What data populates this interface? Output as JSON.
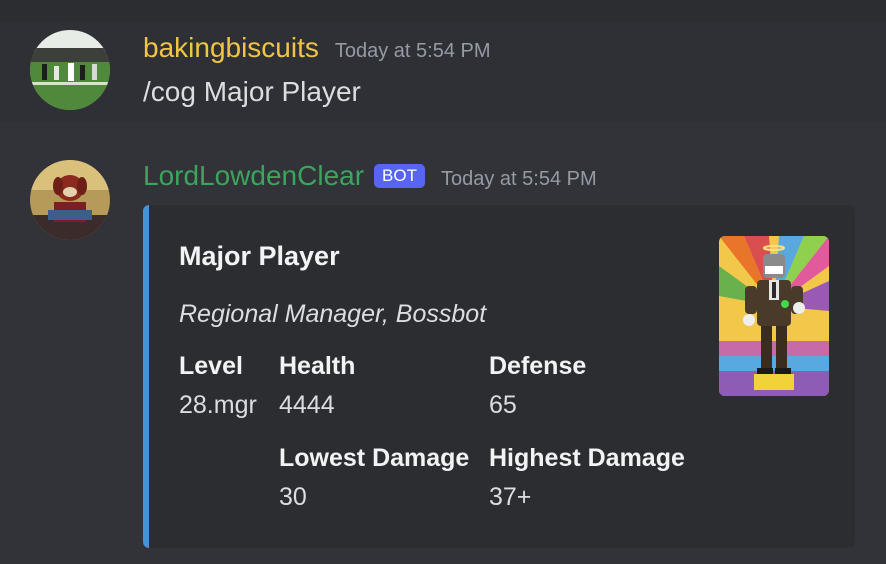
{
  "messages": [
    {
      "username": "bakingbiscuits",
      "timestamp": "Today at 5:54 PM",
      "content": "/cog Major Player"
    },
    {
      "username": "LordLowdenClear",
      "bot_tag": "BOT",
      "timestamp": "Today at 5:54 PM",
      "embed": {
        "title": "Major Player",
        "description": "Regional Manager, Bossbot",
        "accent_color": "#4a90d9",
        "fields": {
          "level": {
            "name": "Level",
            "value": "28.mgr"
          },
          "health": {
            "name": "Health",
            "value": "4444"
          },
          "defense": {
            "name": "Defense",
            "value": "65"
          },
          "lowest_damage": {
            "name": "Lowest Damage",
            "value": "30"
          },
          "highest_damage": {
            "name": "Highest Damage",
            "value": "37+"
          }
        }
      }
    }
  ],
  "colors": {
    "background": "#313338",
    "embed_background": "#2b2d31",
    "username_1": "#f0c544",
    "username_2": "#3ba55d",
    "bot_tag": "#5865f2"
  }
}
